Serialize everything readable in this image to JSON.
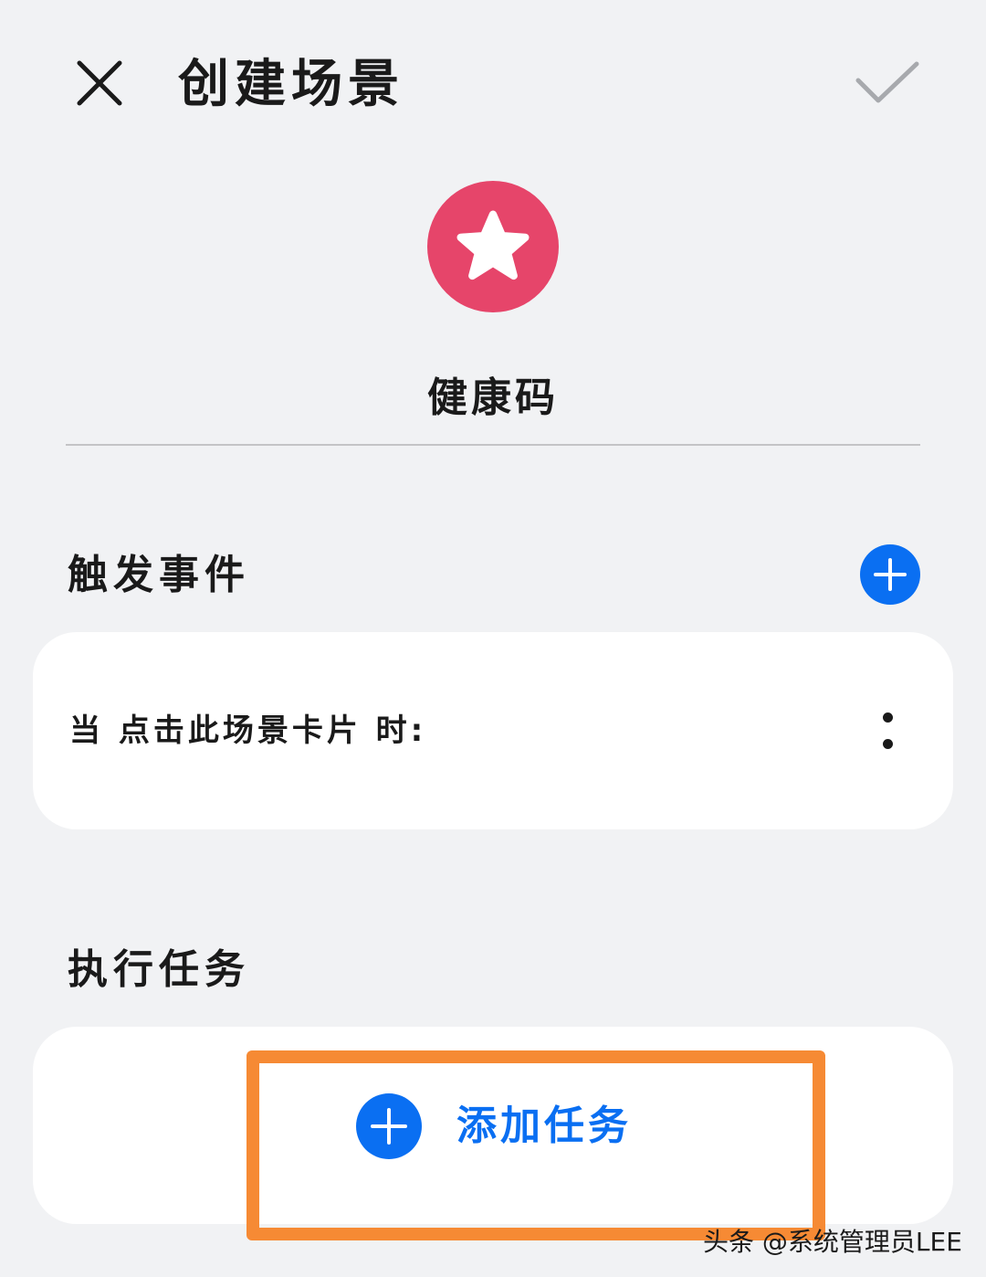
{
  "header": {
    "title": "创建场景",
    "close_icon": "close-icon",
    "confirm_icon": "check-icon"
  },
  "scene": {
    "icon": "star-icon",
    "name": "健康码"
  },
  "trigger_section": {
    "title": "触发事件",
    "add_icon": "plus-icon",
    "condition_text": "当 点击此场景卡片 时:",
    "more_icon": "more-vertical-icon"
  },
  "task_section": {
    "title": "执行任务",
    "add_task_label": "添加任务",
    "add_icon": "plus-icon"
  },
  "watermark": "头条 @系统管理员LEE",
  "colors": {
    "background": "#f1f2f4",
    "card": "#ffffff",
    "accent_blue": "#0a6ff2",
    "scene_red": "#e6456a",
    "highlight_orange": "#f68a34",
    "confirm_gray": "#a7a9ad",
    "text_primary": "#1a1a1a"
  }
}
